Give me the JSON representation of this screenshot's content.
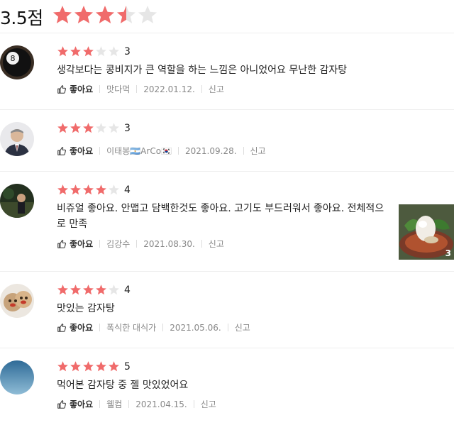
{
  "summary": {
    "score_label": "3.5점",
    "rating": 3.5,
    "max": 5
  },
  "colors": {
    "star_on": "#f06b6b",
    "star_off": "#e6e6e6",
    "divider": "#eeeeee"
  },
  "like_icon": "thumbs-up-icon",
  "reviews": [
    {
      "rating": 3,
      "rating_label": "3",
      "text": "생각보다는 콩비지가 큰 역할을 하는 느낌은 아니었어요 무난한 감자탕",
      "like": "좋아요",
      "author": "맛다먹",
      "date": "2022.01.12.",
      "report": "신고"
    },
    {
      "rating": 3,
      "rating_label": "3",
      "text": "",
      "like": "좋아요",
      "author": "이태봉🇦🇷ArCo🇰🇷",
      "date": "2021.09.28.",
      "report": "신고"
    },
    {
      "rating": 4,
      "rating_label": "4",
      "text": "비쥬얼 좋아요. 안맵고 담백한것도 좋아요. 고기도 부드러워서 좋아요. 전체적으로 만족",
      "like": "좋아요",
      "author": "김강수",
      "date": "2021.08.30.",
      "report": "신고",
      "photo_count": "3"
    },
    {
      "rating": 4,
      "rating_label": "4",
      "text": "맛있는 감자탕",
      "like": "좋아요",
      "author": "폭식한 대식가",
      "date": "2021.05.06.",
      "report": "신고"
    },
    {
      "rating": 5,
      "rating_label": "5",
      "text": "먹어본 감자탕 중 젤 맛있었어요",
      "like": "좋아요",
      "author": "웰컴",
      "date": "2021.04.15.",
      "report": "신고"
    }
  ]
}
